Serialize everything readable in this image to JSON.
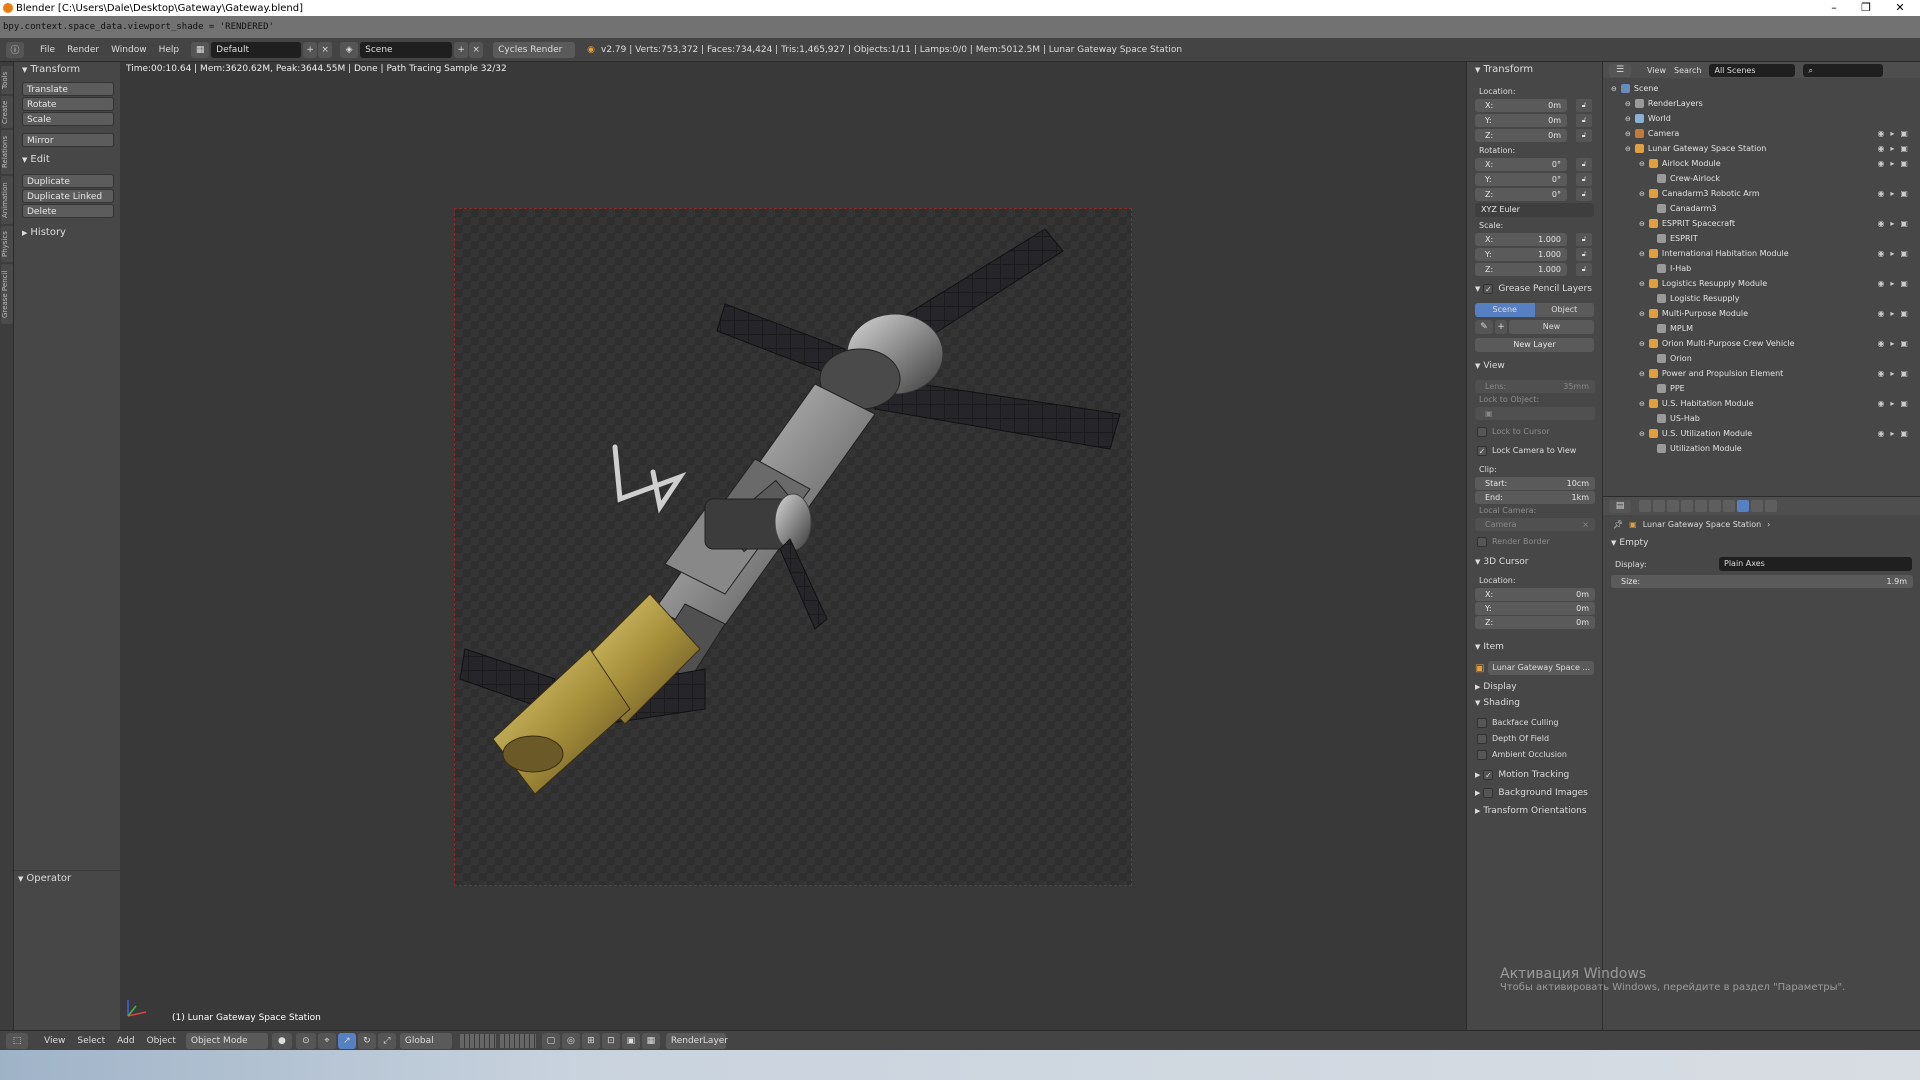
{
  "window": {
    "title": "Blender [C:\\Users\\Dale\\Desktop\\Gateway\\Gateway.blend]",
    "controls": [
      "–",
      "❐",
      "✕"
    ]
  },
  "info": {
    "python_line": "bpy.context.space_data.viewport_shade = 'RENDERED'",
    "menus": [
      "File",
      "Render",
      "Window",
      "Help"
    ],
    "layout": "Default",
    "scene": "Scene",
    "engine": "Cycles Render",
    "stats": "v2.79 | Verts:753,372 | Faces:734,424 | Tris:1,465,927 | Objects:1/11 | Lamps:0/0 | Mem:5012.5M | Lunar Gateway Space Station"
  },
  "viewport": {
    "render_info": "Time:00:10.64 | Mem:3620.62M, Peak:3644.55M | Done | Path Tracing Sample 32/32",
    "object_label": "(1) Lunar Gateway Space Station"
  },
  "tabs": [
    "Tools",
    "Create",
    "Relations",
    "Animation",
    "Physics",
    "Grease Pencil"
  ],
  "toolshelf": {
    "transform_header": "Transform",
    "transform_buttons": [
      "Translate",
      "Rotate",
      "Scale"
    ],
    "mirror": "Mirror",
    "edit_header": "Edit",
    "edit_buttons": [
      "Duplicate",
      "Duplicate Linked",
      "Delete"
    ],
    "history": "History",
    "operator": "Operator"
  },
  "npanel": {
    "transform": "Transform",
    "location_label": "Location:",
    "location": [
      {
        "axis": "X:",
        "value": "0m"
      },
      {
        "axis": "Y:",
        "value": "0m"
      },
      {
        "axis": "Z:",
        "value": "0m"
      }
    ],
    "rotation_label": "Rotation:",
    "rotation": [
      {
        "axis": "X:",
        "value": "0°"
      },
      {
        "axis": "Y:",
        "value": "0°"
      },
      {
        "axis": "Z:",
        "value": "0°"
      }
    ],
    "rotation_mode": "XYZ Euler",
    "scale_label": "Scale:",
    "scale": [
      {
        "axis": "X:",
        "value": "1.000"
      },
      {
        "axis": "Y:",
        "value": "1.000"
      },
      {
        "axis": "Z:",
        "value": "1.000"
      }
    ],
    "grease_pencil": "Grease Pencil Layers",
    "gp_scene": "Scene",
    "gp_object": "Object",
    "gp_new": "New",
    "gp_new_layer": "New Layer",
    "view": "View",
    "lens": "Lens:",
    "lens_value": "35mm",
    "lock_to_object": "Lock to Object:",
    "lock_to_cursor": "Lock to Cursor",
    "lock_camera": "Lock Camera to View",
    "clip": "Clip:",
    "clip_start": "Start:",
    "clip_start_value": "10cm",
    "clip_end": "End:",
    "clip_end_value": "1km",
    "local_camera": "Local Camera:",
    "camera": "Camera",
    "render_border": "Render Border",
    "cursor": "3D Cursor",
    "cursor_location": "Location:",
    "cursor_axes": [
      {
        "axis": "X:",
        "value": "0m"
      },
      {
        "axis": "Y:",
        "value": "0m"
      },
      {
        "axis": "Z:",
        "value": "0m"
      }
    ],
    "item": "Item",
    "item_name": "Lunar Gateway Space ...",
    "display": "Display",
    "shading": "Shading",
    "backface": "Backface Culling",
    "dof": "Depth Of Field",
    "ao": "Ambient Occlusion",
    "motion_tracking": "Motion Tracking",
    "background_images": "Background Images",
    "transform_orientations": "Transform Orientations"
  },
  "outliner": {
    "view": "View",
    "search": "Search",
    "filter": "All Scenes",
    "rows": [
      {
        "label": "Scene",
        "indent": 0
      },
      {
        "label": "RenderLayers",
        "indent": 1
      },
      {
        "label": "World",
        "indent": 1
      },
      {
        "label": "Camera",
        "indent": 1
      },
      {
        "label": "Lunar Gateway Space Station",
        "indent": 1
      },
      {
        "label": "Airlock Module",
        "indent": 2
      },
      {
        "label": "Crew-Airlock",
        "indent": 3
      },
      {
        "label": "Canadarm3 Robotic Arm",
        "indent": 2
      },
      {
        "label": "Canadarm3",
        "indent": 3
      },
      {
        "label": "ESPRIT Spacecraft",
        "indent": 2
      },
      {
        "label": "ESPRIT",
        "indent": 3
      },
      {
        "label": "International Habitation Module",
        "indent": 2
      },
      {
        "label": "I-Hab",
        "indent": 3
      },
      {
        "label": "Logistics Resupply Module",
        "indent": 2
      },
      {
        "label": "Logistic Resupply",
        "indent": 3
      },
      {
        "label": "Multi-Purpose Module",
        "indent": 2
      },
      {
        "label": "MPLM",
        "indent": 3
      },
      {
        "label": "Orion Multi-Purpose Crew Vehicle",
        "indent": 2
      },
      {
        "label": "Orion",
        "indent": 3
      },
      {
        "label": "Power and Propulsion Element",
        "indent": 2
      },
      {
        "label": "PPE",
        "indent": 3
      },
      {
        "label": "U.S. Habitation Module",
        "indent": 2
      },
      {
        "label": "US-Hab",
        "indent": 3
      },
      {
        "label": "U.S. Utilization Module",
        "indent": 2
      },
      {
        "label": "Utilization Module",
        "indent": 3
      }
    ]
  },
  "properties": {
    "breadcrumb": "Lunar Gateway Space Station",
    "panel": "Empty",
    "display_label": "Display:",
    "display_value": "Plain Axes",
    "size_label": "Size:",
    "size_value": "1.9m"
  },
  "bottom": {
    "menus": [
      "View",
      "Select",
      "Add",
      "Object"
    ],
    "mode": "Object Mode",
    "orientation": "Global",
    "render_layer": "RenderLayer"
  },
  "watermark": {
    "line1": "Активация Windows",
    "line2": "Чтобы активировать Windows, перейдите в раздел \"Параметры\"."
  },
  "colors": {
    "accent": "#5680c2",
    "camera_frame": "#8a2a2a",
    "gold_foil": "#b8a14a"
  }
}
